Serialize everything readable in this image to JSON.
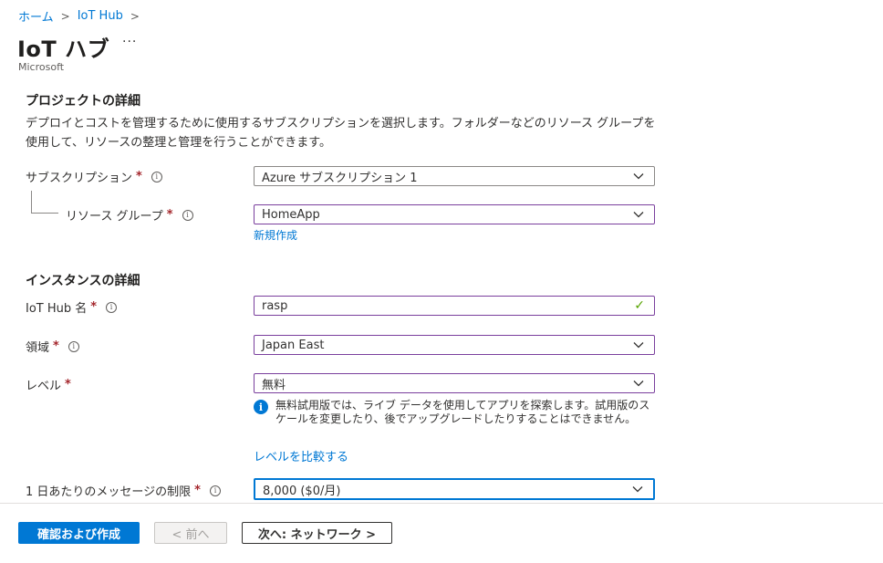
{
  "breadcrumb": {
    "home": "ホーム",
    "iothub": "IoT Hub",
    "separator": ">"
  },
  "header": {
    "title": "IoT ハブ",
    "more": "···",
    "publisher": "Microsoft"
  },
  "project": {
    "title": "プロジェクトの詳細",
    "description": "デプロイとコストを管理するために使用するサブスクリプションを選択します。フォルダーなどのリソース グループを使用して、リソースの整理と管理を行うことができます。",
    "subscription_label": "サブスクリプション",
    "subscription_value": "Azure サブスクリプション 1",
    "resource_group_label": "リソース グループ",
    "resource_group_value": "HomeApp",
    "create_new_link": "新規作成"
  },
  "instance": {
    "title": "インスタンスの詳細",
    "name_label": "IoT Hub 名",
    "name_value": "rasp",
    "region_label": "領域",
    "region_value": "Japan East",
    "tier_label": "レベル",
    "tier_value": "無料",
    "tier_notice": "無料試用版では、ライブ データを使用してアプリを探索します。試用版のスケールを変更したり、後でアップグレードしたりすることはできません。",
    "compare_link": "レベルを比較する",
    "daily_limit_label": "1 日あたりのメッセージの制限",
    "daily_limit_value": "8,000 ($0/月)"
  },
  "markers": {
    "required": "*",
    "info": "i"
  },
  "footer": {
    "review_create": "確認および作成",
    "previous": "< 前へ",
    "next": "次へ: ネットワーク >"
  },
  "colors": {
    "accent": "#0078d4",
    "required": "#a4262c",
    "valid": "#57a300",
    "active_border": "#7a3f9d"
  }
}
